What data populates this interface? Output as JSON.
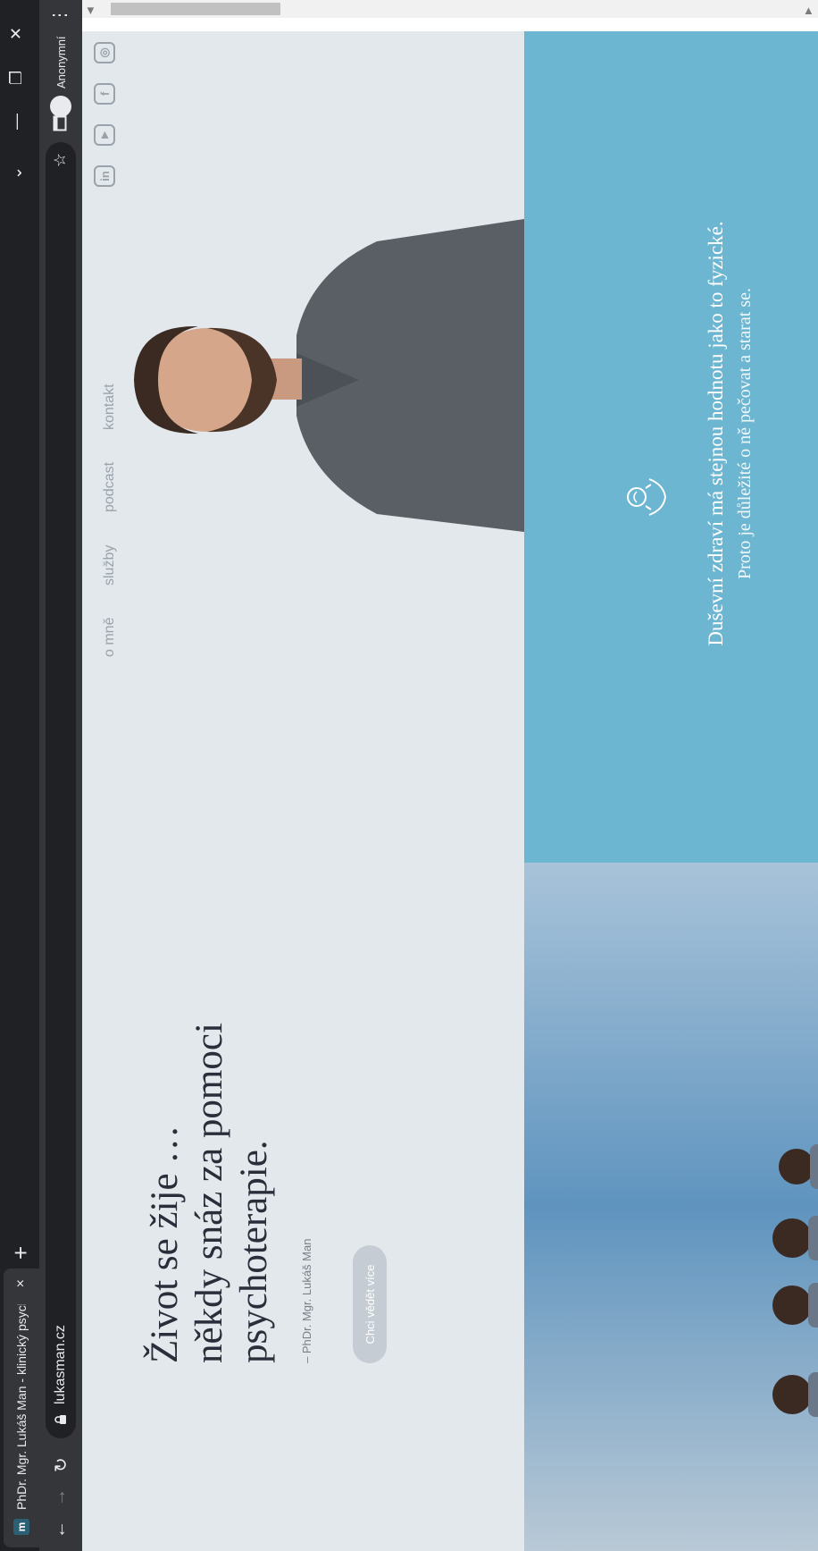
{
  "browser": {
    "tab_title": "PhDr. Mgr. Lukáš Man - klinický psycholog",
    "tab_favicon": "m",
    "tab_close": "×",
    "new_tab": "+",
    "url": "lukasman.cz",
    "profile_label": "Anonymní"
  },
  "hero": {
    "headline_line1": "Život se žije …",
    "headline_line2": "někdy snáz za pomoci",
    "headline_line3": "psychoterapie.",
    "attribution": "– PhDr. Mgr. Lukáš Man",
    "cta_label": "Chci vědět více"
  },
  "nav": {
    "items": [
      "o mně",
      "služby",
      "podcast",
      "kontakt"
    ]
  },
  "social": [
    "in",
    "▶",
    "f",
    "◎"
  ],
  "info": {
    "tagline": "Duševní zdraví má stejnou hodnotu jako to fyzické.",
    "tagline_2": "Proto je důležité o ně pečovat a starat se."
  },
  "colors": {
    "hero_bg": "#e2e8ec",
    "info_bg": "#6db6d1",
    "headline": "#2a2e3a",
    "nav": "#9aa3ab"
  }
}
